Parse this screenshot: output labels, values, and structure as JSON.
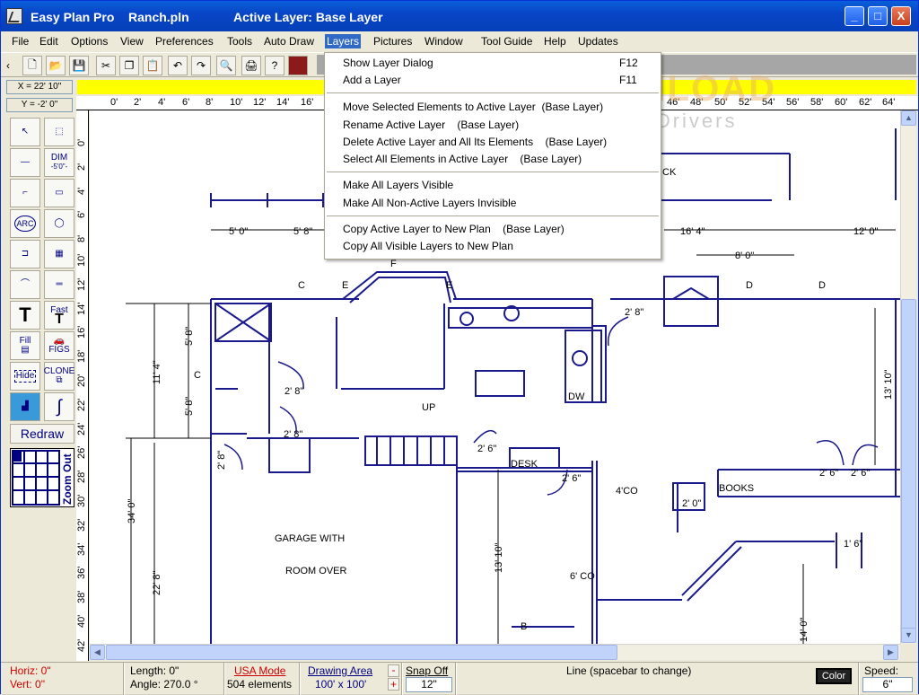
{
  "window": {
    "app_name": "Easy Plan Pro",
    "file_name": "Ranch.pln",
    "active_layer": "Active Layer: Base Layer",
    "buttons": {
      "minimize": "_",
      "maximize": "□",
      "close": "X"
    }
  },
  "menubar": [
    "File",
    "Edit",
    "Options",
    "View",
    "Preferences",
    "Tools",
    "Auto Draw",
    "Layers",
    "Pictures",
    "Window",
    "Tool Guide",
    "Help",
    "Updates"
  ],
  "coords": {
    "x": "X = 22' 10\"",
    "y": "Y = -2' 0\""
  },
  "ruler": {
    "h_labels": [
      "0'",
      "2'",
      "4'",
      "6'",
      "8'",
      "10'",
      "12'",
      "14'",
      "16'",
      "46'",
      "48'",
      "50'",
      "52'",
      "54'",
      "56'",
      "58'",
      "60'",
      "62'",
      "64'"
    ],
    "v_labels": [
      "0'",
      "2'",
      "4'",
      "6'",
      "8'",
      "10'",
      "12'",
      "14'",
      "16'",
      "18'",
      "20'",
      "22'",
      "24'",
      "26'",
      "28'",
      "30'",
      "32'",
      "34'",
      "36'",
      "38'",
      "40'",
      "42'"
    ]
  },
  "left_panel": {
    "dim_label": "DIM",
    "dim_sub": "-5'0\"-",
    "arc_label": "ARC",
    "fast_label": "Fast",
    "fill_label": "Fill",
    "figs_label": "FIGS",
    "hide_label": "Hide",
    "clone_label": "CLONE",
    "redraw_label": "Redraw",
    "zoom_out_label": "Zoom Out"
  },
  "layers_menu": {
    "items": [
      {
        "label": "Show Layer Dialog",
        "shortcut": "F12"
      },
      {
        "label": "Add a Layer",
        "shortcut": "F11"
      },
      {
        "label": "Move Selected Elements to Active Layer  (Base Layer)",
        "shortcut": ""
      },
      {
        "label": "Rename Active Layer    (Base Layer)",
        "shortcut": ""
      },
      {
        "label": "Delete Active Layer and All Its Elements    (Base Layer)",
        "shortcut": ""
      },
      {
        "label": "Select All Elements in Active Layer    (Base Layer)",
        "shortcut": ""
      },
      {
        "label": "Make All Layers Visible",
        "shortcut": ""
      },
      {
        "label": "Make All Non-Active Layers Invisible",
        "shortcut": ""
      },
      {
        "label": "Copy Active Layer to New Plan    (Base Layer)",
        "shortcut": ""
      },
      {
        "label": "Copy All Visible Layers to New Plan",
        "shortcut": ""
      }
    ]
  },
  "watermark": {
    "main": "FIBERDOWNLOAD",
    "sub": "Software - Games - Drivers"
  },
  "plan": {
    "labels": {
      "garage_1": "GARAGE WITH",
      "garage_2": "ROOM OVER",
      "up": "UP",
      "dw": "DW",
      "desk": "DESK",
      "books": "BOOKS",
      "co4": "4'CO",
      "co6": "6' CO",
      "b": "B",
      "c1": "C",
      "c2": "C",
      "f": "F",
      "e1": "E",
      "e2": "E",
      "d1": "D",
      "d2": "D",
      "ck": "CK"
    },
    "dims": {
      "d5_0": "5' 0\"",
      "d5_8": "5' 8\"",
      "d16_4": "16' 4\"",
      "d12_0": "12' 0\"",
      "d8_0": "8' 0\"",
      "d2_8a": "2' 8\"",
      "d2_8b": "2' 8\"",
      "d2_8c": "2' 8\"",
      "d2_8d": "2' 8\"",
      "d2_6a": "2' 6\"",
      "d2_6b": "2' 6\"",
      "d2_6c": "2' 6\"",
      "d2_6d": "2' 6\"",
      "d11_4": "11' 4\"",
      "d5_8v1": "5' 8\"",
      "d5_8v2": "5' 8\"",
      "d34_0": "34' 0\"",
      "d22_8": "22' 8\"",
      "d13_10a": "13' 10\"",
      "d13_10b": "13' 10\"",
      "d14_0": "14' 0\"",
      "d2_0": "2' 0\"",
      "d1_6": "1' 6\""
    }
  },
  "status": {
    "horiz": "Horiz: 0\"",
    "vert": "Vert: 0\"",
    "length": "Length: 0\"",
    "angle": "Angle: 270.0 °",
    "usa_mode": "USA Mode",
    "elements": "504 elements",
    "drawing_area": "Drawing Area",
    "area_size": "100' x 100'",
    "snap": "Snap Off",
    "snap_value": "12\"",
    "line_mode": "Line  (spacebar to change)",
    "color": "Color",
    "speed": "Speed:",
    "speed_value": "6\""
  },
  "colors": {
    "plan_line": "#1a1a8c",
    "title_bar": "#0846c7",
    "menu_highlight": "#316ac5",
    "status_red": "#cc0000",
    "status_blue": "#000080"
  }
}
